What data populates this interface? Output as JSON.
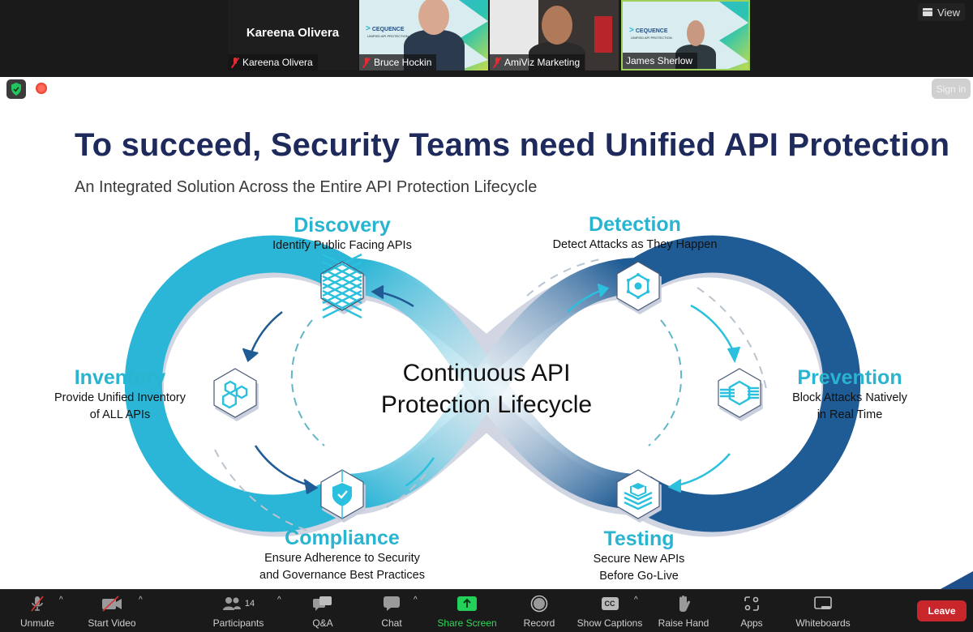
{
  "gallery": {
    "active_speaker": {
      "display_name": "Kareena Olivera",
      "tag_name": "Kareena Olivera",
      "muted": true
    },
    "videos": [
      {
        "name": "Bruce Hockin",
        "muted": true,
        "background_brand": "CEQUENCE",
        "background_brand_sub": "UNIFIED API PROTECTION"
      },
      {
        "name": "AmiViz Marketing",
        "muted": true
      },
      {
        "name": "James Sherlow",
        "muted": false,
        "background_brand": "CEQUENCE",
        "background_brand_sub": "UNIFIED API PROTECTION"
      }
    ],
    "view_button": {
      "label": "View",
      "icon": "grid-view-icon"
    }
  },
  "meeting_controls": {
    "security_icon": "shield-check-icon",
    "recording_indicator": "recording-dot-icon",
    "sign_in_label": "Sign in"
  },
  "slide": {
    "title": "To succeed, Security Teams need Unified API Protection",
    "subtitle": "An Integrated Solution Across the Entire API Protection Lifecycle",
    "center_line1": "Continuous API",
    "center_line2": "Protection Lifecycle",
    "colors": {
      "title": "#1f2a5c",
      "stage_name": "#29b4d0",
      "left_loop": "#2bb5d6",
      "right_loop": "#1f5b94"
    },
    "stages": [
      {
        "id": "discovery",
        "name": "Discovery",
        "desc1": "Identify Public Facing APIs",
        "desc2": "",
        "icon": "grid-mesh-icon"
      },
      {
        "id": "inventory",
        "name": "Inventory",
        "desc1": "Provide Unified Inventory",
        "desc2": "of ALL APIs",
        "icon": "cubes-icon"
      },
      {
        "id": "compliance",
        "name": "Compliance",
        "desc1": "Ensure Adherence to Security",
        "desc2": "and Governance Best Practices",
        "icon": "shield-check-icon"
      },
      {
        "id": "detection",
        "name": "Detection",
        "desc1": "Detect Attacks as They Happen",
        "desc2": "",
        "icon": "network-node-icon"
      },
      {
        "id": "prevention",
        "name": "Prevention",
        "desc1": "Block Attacks Natively",
        "desc2": "in Real Time",
        "icon": "shield-block-icon"
      },
      {
        "id": "testing",
        "name": "Testing",
        "desc1": "Secure New APIs",
        "desc2": "Before Go-Live",
        "icon": "layers-icon"
      }
    ]
  },
  "toolbar": {
    "unmute": "Unmute",
    "start_video": "Start Video",
    "participants": "Participants",
    "participants_count": "14",
    "qa": "Q&A",
    "chat": "Chat",
    "share_screen": "Share Screen",
    "record": "Record",
    "show_captions": "Show Captions",
    "captions_badge": "CC",
    "raise_hand": "Raise Hand",
    "apps": "Apps",
    "whiteboards": "Whiteboards",
    "leave": "Leave"
  }
}
